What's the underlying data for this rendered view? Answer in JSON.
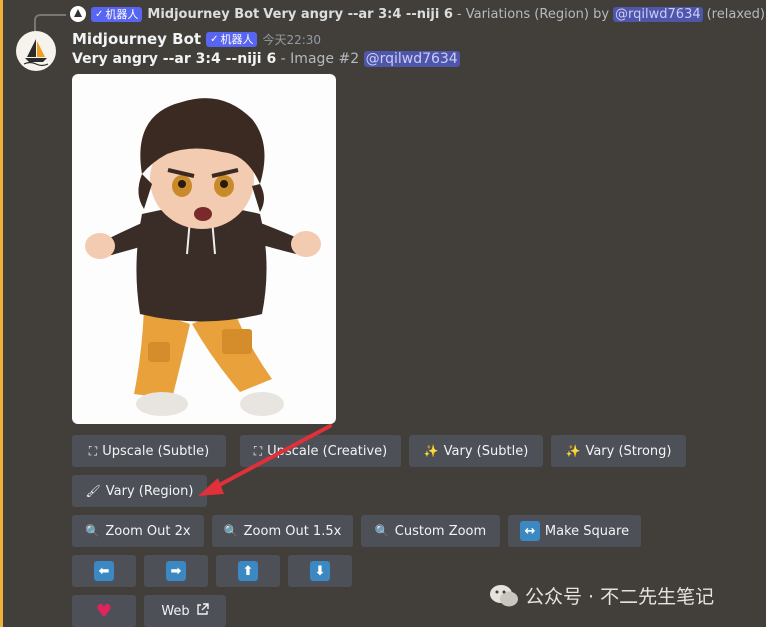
{
  "reply": {
    "bot_name": "Midjourney Bot",
    "bot_tag": "机器人",
    "prompt": "Very angry --ar 3:4 --niji 6",
    "suffix": "- Variations (Region) by",
    "mention": "@rqilwd7634",
    "mode": "(relaxed)"
  },
  "message": {
    "author": "Midjourney Bot",
    "bot_tag": "机器人",
    "timestamp": "今天22:30",
    "prompt": "Very angry --ar 3:4 --niji 6",
    "suffix": "- Image #2",
    "mention": "@rqilwd7634"
  },
  "buttons": {
    "upscale_subtle": "Upscale (Subtle)",
    "upscale_creative": "Upscale (Creative)",
    "vary_subtle": "Vary (Subtle)",
    "vary_strong": "Vary (Strong)",
    "vary_region": "Vary (Region)",
    "zoom_out_2x": "Zoom Out 2x",
    "zoom_out_15x": "Zoom Out 1.5x",
    "custom_zoom": "Custom Zoom",
    "make_square": "Make Square",
    "web": "Web"
  },
  "icons": {
    "pan_left": "arrow-left",
    "pan_right": "arrow-right",
    "pan_up": "arrow-up",
    "pan_down": "arrow-down",
    "favorite": "heart"
  },
  "watermark": {
    "text": "公众号 · 不二先生笔记"
  },
  "colors": {
    "background": "#423f3a",
    "accent_bar": "#f0b232",
    "button": "#4e5058",
    "bot_tag": "#5865f2",
    "arrow_annotation": "#e0303a"
  }
}
